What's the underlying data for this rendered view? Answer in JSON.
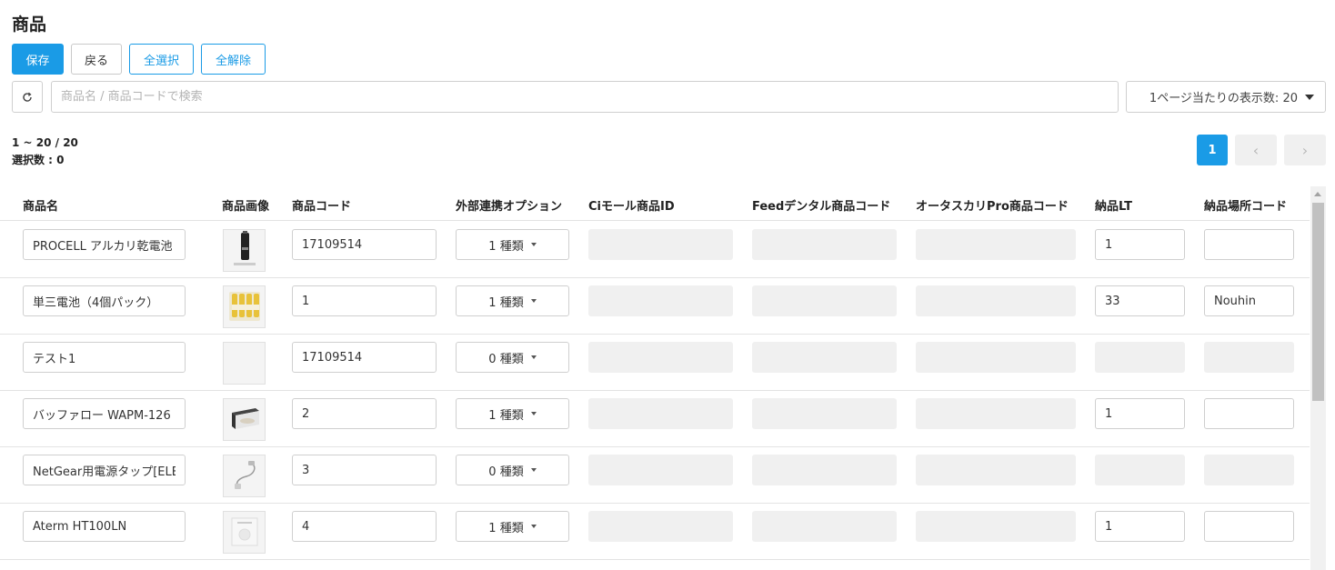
{
  "page": {
    "title": "商品"
  },
  "toolbar": {
    "save_label": "保存",
    "back_label": "戻る",
    "select_all_label": "全選択",
    "deselect_all_label": "全解除"
  },
  "search": {
    "placeholder": "商品名 / 商品コードで検索",
    "value": ""
  },
  "per_page": {
    "label": "1ページ当たりの表示数: 20"
  },
  "stats": {
    "range": "1 ~ 20 / 20",
    "selected": "選択数 : 0"
  },
  "pagination": {
    "current": "1",
    "prev": "‹",
    "next": "›"
  },
  "table": {
    "headers": {
      "name": "商品名",
      "image": "商品画像",
      "code": "商品コード",
      "option": "外部連携オプション",
      "ci_id": "Ciモール商品ID",
      "feed_code": "Feedデンタル商品コード",
      "otasukari_code": "オータスカリPro商品コード",
      "lt": "納品LT",
      "place": "納品場所コード"
    },
    "rows": [
      {
        "name": "PROCELL アルカリ乾電池",
        "image": "battery-icon",
        "code": "17109514",
        "option": "1 種類",
        "lt": "1",
        "place": "",
        "disabled": false
      },
      {
        "name": "単三電池（4個パック）",
        "image": "battery-pack-icon",
        "code": "1",
        "option": "1 種類",
        "lt": "33",
        "place": "Nouhin",
        "disabled": false
      },
      {
        "name": "テスト1",
        "image": "",
        "code": "17109514",
        "option": "0 種類",
        "lt": "",
        "place": "",
        "disabled": true
      },
      {
        "name": "バッファロー WAPM-126",
        "image": "router-icon",
        "code": "2",
        "option": "1 種類",
        "lt": "1",
        "place": "",
        "disabled": false
      },
      {
        "name": "NetGear用電源タップ[ELE",
        "image": "cable-icon",
        "code": "3",
        "option": "0 種類",
        "lt": "",
        "place": "",
        "disabled": true
      },
      {
        "name": "Aterm HT100LN",
        "image": "device-box-icon",
        "code": "4",
        "option": "1 種類",
        "lt": "1",
        "place": "",
        "disabled": false
      }
    ]
  },
  "colors": {
    "primary": "#1a9be6",
    "border": "#cfcfcf",
    "disabled_bg": "#f0f0f0"
  }
}
